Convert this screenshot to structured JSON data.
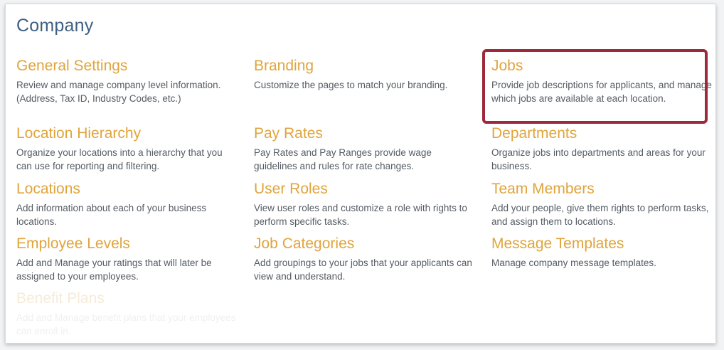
{
  "page": {
    "title": "Company"
  },
  "colors": {
    "title": "#3e5f82",
    "item_title": "#e0a43c",
    "description": "#555b63",
    "highlight": "#9c2a3a"
  },
  "rows": [
    [
      {
        "title": "General Settings",
        "description": "Review and manage company level information. (Address, Tax ID, Industry Codes, etc.)"
      },
      {
        "title": "Branding",
        "description": "Customize the pages to match your branding."
      },
      {
        "title": "Jobs",
        "description": "Provide job descriptions for applicants, and manage which jobs are available at each location."
      }
    ],
    [
      {
        "title": "Location Hierarchy",
        "description": "Organize your locations into a hierarchy that you can use for reporting and filtering."
      },
      {
        "title": "Pay Rates",
        "description": "Pay Rates and Pay Ranges provide wage guidelines and rules for rate changes."
      },
      {
        "title": "Departments",
        "description": "Organize jobs into departments and areas for your business."
      }
    ],
    [
      {
        "title": "Locations",
        "description": "Add information about each of your business locations."
      },
      {
        "title": "User Roles",
        "description": "View user roles and customize a role with rights to perform specific tasks."
      },
      {
        "title": "Team Members",
        "description": "Add your people, give them rights to perform tasks, and assign them to locations."
      }
    ],
    [
      {
        "title": "Employee Levels",
        "description": "Add and Manage your ratings that will later be assigned to your employees."
      },
      {
        "title": "Job Categories",
        "description": "Add groupings to your jobs that your applicants can view and understand."
      },
      {
        "title": "Message Templates",
        "description": "Manage company message templates."
      }
    ],
    [
      {
        "title": "Benefit Plans",
        "description": "Add and Manage benefit plans that your employees can enroll in."
      }
    ]
  ]
}
